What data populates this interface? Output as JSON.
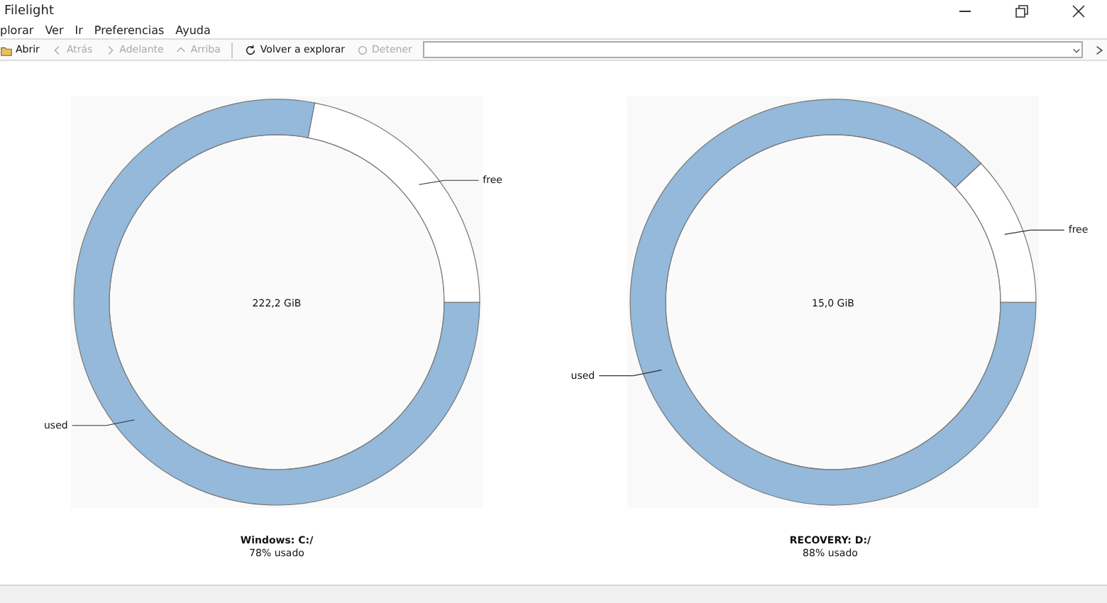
{
  "window": {
    "title": "Filelight"
  },
  "menu": [
    "plorar",
    "Ver",
    "Ir",
    "Preferencias",
    "Ayuda"
  ],
  "toolbar": [
    {
      "label": "Abrir",
      "disabled": false
    },
    {
      "label": "Atrás",
      "disabled": true
    },
    {
      "label": "Adelante",
      "disabled": true
    },
    {
      "label": "Arriba",
      "disabled": true
    },
    {
      "label": "Volver a explorar",
      "disabled": false
    },
    {
      "label": "Detener",
      "disabled": true
    }
  ],
  "disks": [
    {
      "name": "Windows: C:/",
      "usage": "78% usado",
      "size": "222,2 GiB",
      "chart_data": {
        "type": "donut",
        "categories": [
          "used",
          "free"
        ],
        "values": [
          78,
          22
        ]
      }
    },
    {
      "name": "RECOVERY: D:/",
      "usage": "88% usado",
      "size": "15,0 GiB",
      "chart_data": {
        "type": "donut",
        "categories": [
          "used",
          "free"
        ],
        "values": [
          88,
          12
        ]
      }
    }
  ]
}
